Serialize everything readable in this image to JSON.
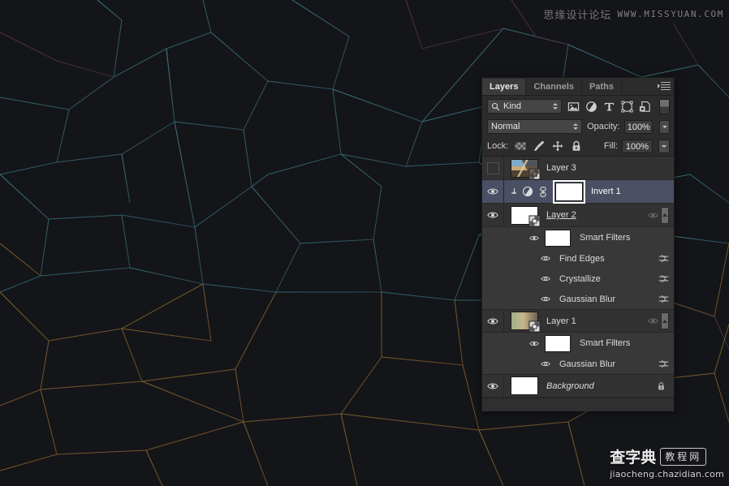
{
  "watermarks": {
    "top_cn": "思缘设计论坛",
    "top_url": "WWW.MISSYUAN.COM",
    "bottom_cn": "查字典",
    "bottom_box": "教程网",
    "bottom_url": "jiaocheng.chazidian.com"
  },
  "panel": {
    "tabs": [
      {
        "label": "Layers",
        "active": true
      },
      {
        "label": "Channels",
        "active": false
      },
      {
        "label": "Paths",
        "active": false
      }
    ],
    "menu_icon": "panel-menu-icon",
    "filter": {
      "kind_label": "Kind",
      "search_icon": "search-icon",
      "type_icons": [
        "image-filter-icon",
        "adjustment-filter-icon",
        "type-filter-icon",
        "shape-filter-icon",
        "smart-object-filter-icon"
      ],
      "toggle_icon": "filter-enable-toggle"
    },
    "blend": {
      "mode": "Normal",
      "opacity_label": "Opacity:",
      "opacity_value": "100%",
      "fill_label": "Fill:",
      "fill_value": "100%"
    },
    "lock": {
      "label": "Lock:",
      "icons": [
        "lock-transparency-icon",
        "lock-image-pixels-icon",
        "lock-position-icon",
        "lock-all-icon"
      ]
    },
    "layers": [
      {
        "name": "Layer 3",
        "visible": false,
        "selected": false,
        "thumb": "photo",
        "smart_object": true,
        "name_style": "normal"
      },
      {
        "name": "Invert 1",
        "visible": true,
        "selected": true,
        "thumb": "white-mask",
        "clipping_mask": true,
        "adjustment_icon": "invert-adjustment-icon",
        "link_icon": "mask-link-icon",
        "mask_selected": true,
        "name_style": "normal"
      },
      {
        "name": "Layer 2",
        "visible": true,
        "selected": false,
        "thumb": "white",
        "smart_object": true,
        "name_style": "underlined",
        "has_fx_eye": true,
        "has_collapse": true,
        "smart_filters": {
          "label": "Smart Filters",
          "mask_visible": true,
          "filters": [
            {
              "name": "Find Edges",
              "visible": true
            },
            {
              "name": "Crystallize",
              "visible": true
            },
            {
              "name": "Gaussian Blur",
              "visible": true
            }
          ]
        }
      },
      {
        "name": "Layer 1",
        "visible": true,
        "selected": false,
        "thumb": "gradient",
        "smart_object": true,
        "name_style": "normal",
        "has_fx_eye": true,
        "has_collapse": true,
        "smart_filters": {
          "label": "Smart Filters",
          "mask_visible": true,
          "filters": [
            {
              "name": "Gaussian Blur",
              "visible": true
            }
          ]
        }
      },
      {
        "name": "Background",
        "visible": true,
        "selected": false,
        "thumb": "white",
        "locked": true,
        "name_style": "italic"
      }
    ]
  }
}
